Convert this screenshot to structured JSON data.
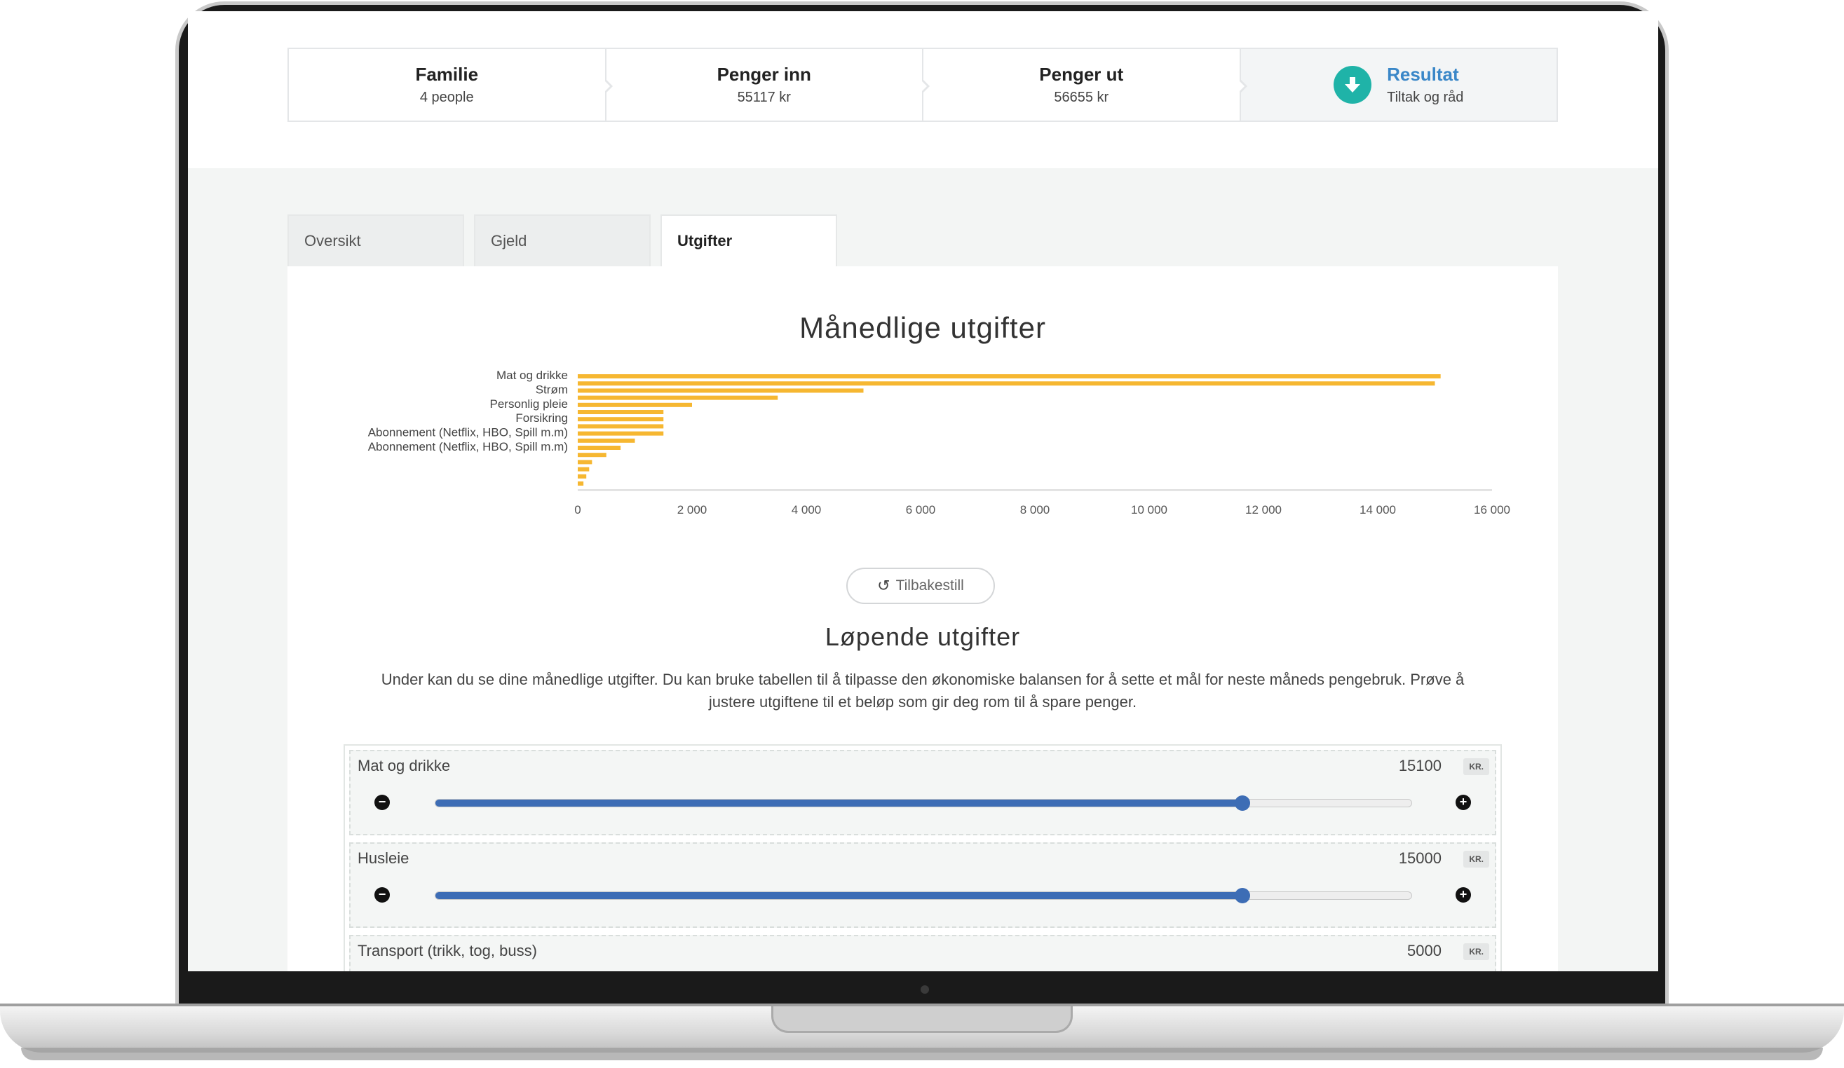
{
  "steps": [
    {
      "title": "Familie",
      "sub": "4 people"
    },
    {
      "title": "Penger inn",
      "sub": "55117 kr"
    },
    {
      "title": "Penger ut",
      "sub": "56655 kr"
    },
    {
      "title": "Resultat",
      "sub": "Tiltak og råd"
    }
  ],
  "tabs": [
    {
      "label": "Oversikt"
    },
    {
      "label": "Gjeld"
    },
    {
      "label": "Utgifter"
    }
  ],
  "chart_data": {
    "type": "bar",
    "orientation": "horizontal",
    "title": "Månedlige utgifter",
    "categories": [
      "Mat og drikke",
      "",
      "Strøm",
      "",
      "Personlig pleie",
      "",
      "Forsikring",
      "",
      "Abonnement (Netflix, HBO, Spill m.m)",
      "",
      "Abonnement (Netflix, HBO, Spill m.m)",
      "",
      "",
      "",
      "",
      ""
    ],
    "values": [
      15100,
      15000,
      5000,
      3500,
      2000,
      1500,
      1500,
      1500,
      1500,
      1000,
      750,
      500,
      250,
      200,
      150,
      100
    ],
    "xlim": [
      0,
      16000
    ],
    "xticks": [
      "0",
      "2 000",
      "4 000",
      "6 000",
      "8 000",
      "10 000",
      "12 000",
      "14 000",
      "16 000"
    ],
    "bar_color": "#f6b731",
    "grid": false
  },
  "reset_label": "Tilbakestill",
  "section_title": "Løpende utgifter",
  "description": "Under kan du se dine månedlige utgifter. Du kan bruke tabellen til å tilpasse den økonomiske balansen for å sette et mål for neste måneds pengebruk. Prøve å justere utgiftene til et beløp som gir deg rom til å spare penger.",
  "sliders": [
    {
      "label": "Mat og drikke",
      "value": "15100",
      "unit": "KR.",
      "fraction": 0.827
    },
    {
      "label": "Husleie",
      "value": "15000",
      "unit": "KR.",
      "fraction": 0.827
    },
    {
      "label": "Transport (trikk, tog, buss)",
      "value": "5000",
      "unit": "KR.",
      "fraction": 0.3
    }
  ],
  "colors": {
    "accent": "#3a87c8",
    "download_icon": "#1fb3a8",
    "slider": "#3d6db5"
  }
}
